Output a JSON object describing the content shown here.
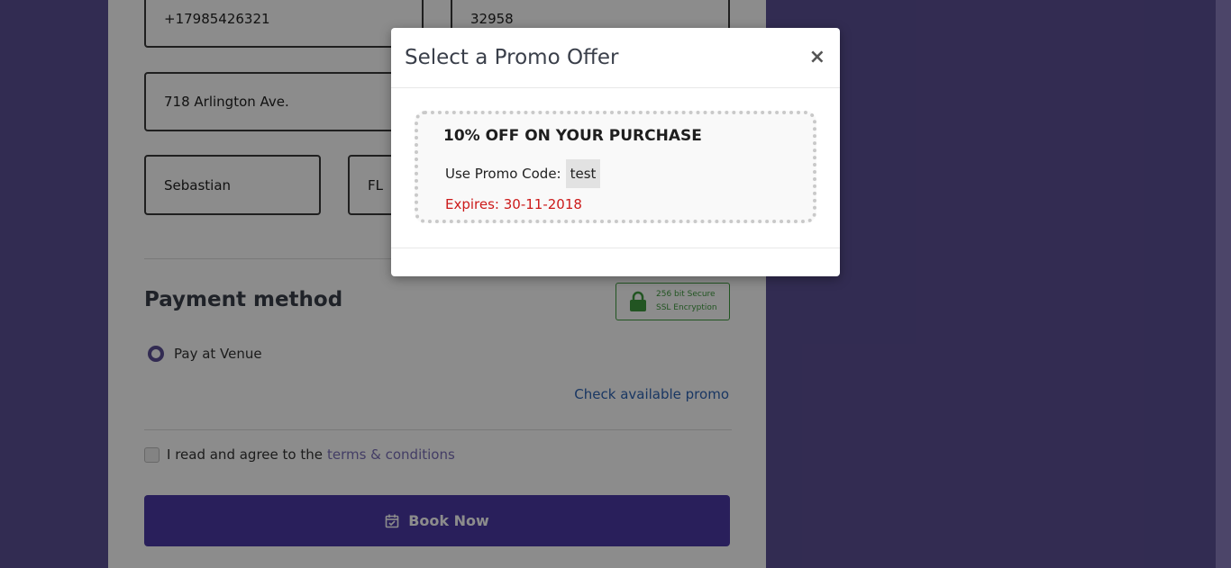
{
  "form": {
    "phone_value": "+17985426321",
    "zip_value": "32958",
    "address_value": "718 Arlington Ave.",
    "city_value": "Sebastian",
    "state_value": "FL"
  },
  "payment": {
    "title": "Payment method",
    "ssl_line1": "256 bit Secure",
    "ssl_line2": "SSL Encryption",
    "option_label": "Pay at Venue",
    "promo_link": "Check available promo"
  },
  "agreement": {
    "text": "I read and agree to the",
    "link": "terms & conditions"
  },
  "book_button": {
    "label": "Book Now"
  },
  "modal": {
    "title": "Select a Promo Offer",
    "close": "×",
    "offer_title": "10% OFF ON YOUR PURCHASE",
    "code_label": "Use Promo Code:",
    "code": "test",
    "expiry": "Expires: 30-11-2018"
  },
  "colors": {
    "page_bg": "#5c5195",
    "button": "#4c3aa6",
    "ssl_green": "#3f9b3f",
    "expiry_red": "#cc1a1a",
    "link_blue": "#2f64b4"
  },
  "icons": [
    "lock-icon",
    "calendar-check-icon",
    "close-icon"
  ]
}
